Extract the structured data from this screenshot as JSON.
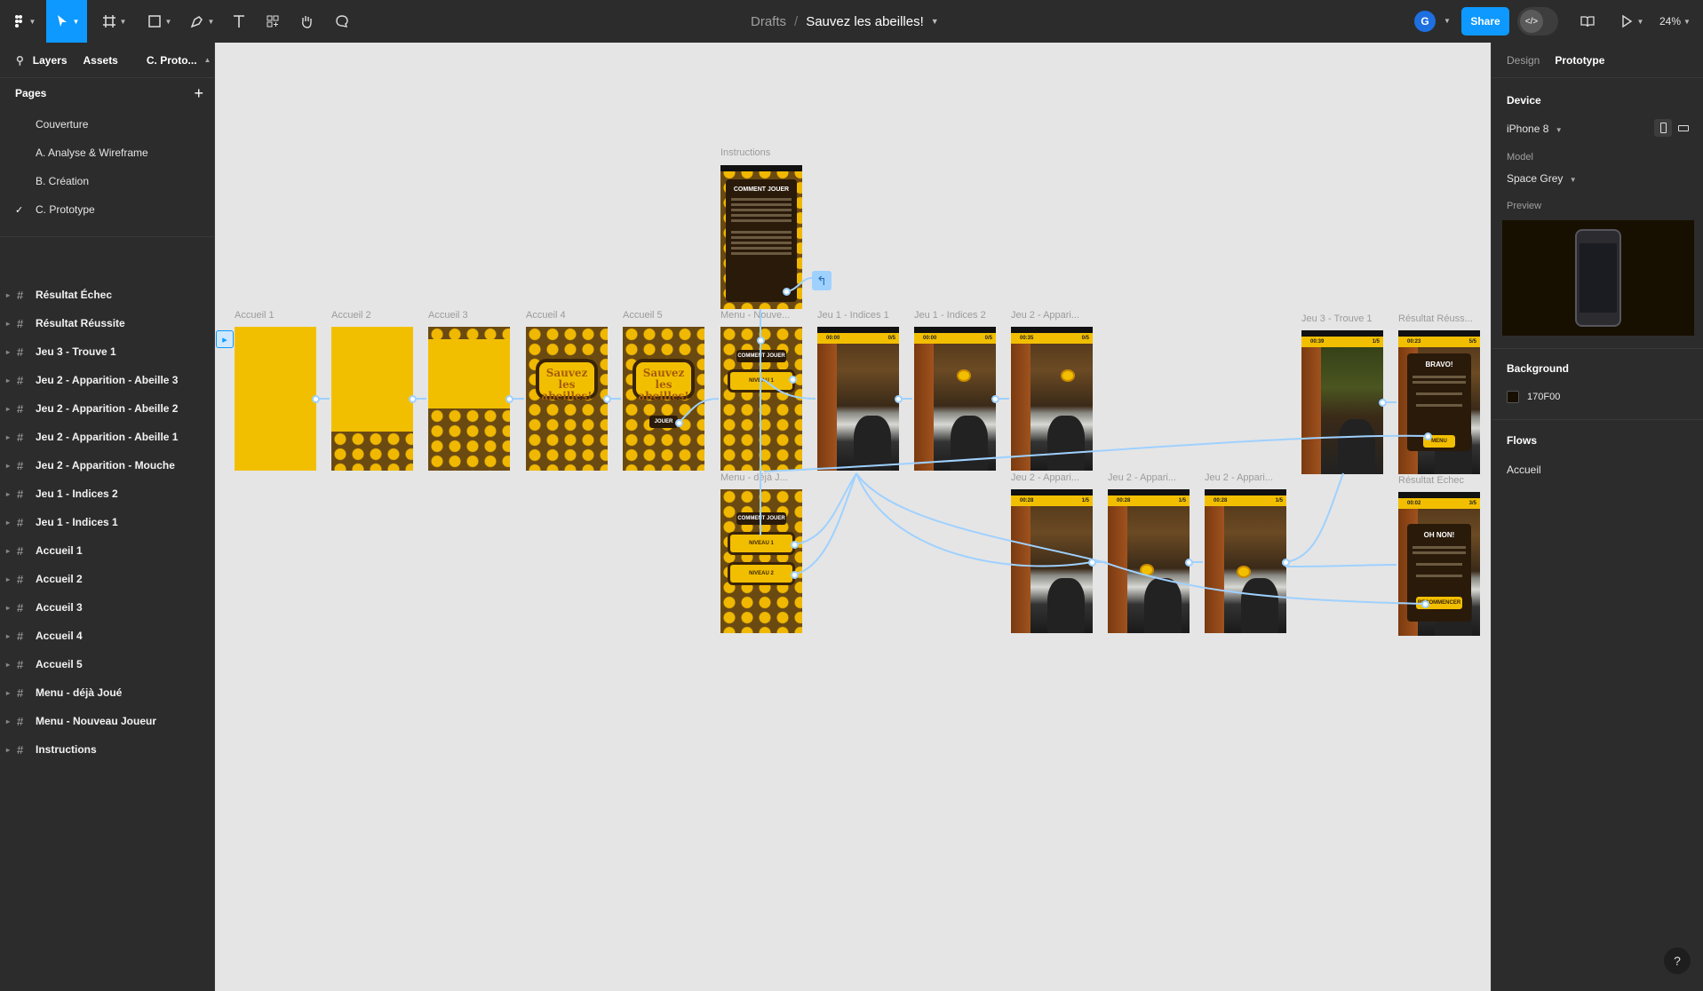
{
  "toolbar": {
    "menu_icon": "figma-logo-icon",
    "breadcrumb_drafts": "Drafts",
    "breadcrumb_sep": "/",
    "file_name": "Sauvez les abeilles!",
    "avatar_initial": "G",
    "share_label": "Share",
    "zoom": "24%"
  },
  "left_panel": {
    "tabs": [
      "Layers",
      "Assets",
      "C. Proto..."
    ],
    "pages_title": "Pages",
    "pages": [
      {
        "label": "Couverture",
        "checked": false
      },
      {
        "label": "A. Analyse & Wireframe",
        "checked": false
      },
      {
        "label": "B. Création",
        "checked": false
      },
      {
        "label": "C. Prototype",
        "checked": true
      }
    ],
    "layers": [
      "Résultat Échec",
      "Résultat Réussite",
      "Jeu 3 - Trouve 1",
      "Jeu 2 - Apparition - Abeille 3",
      "Jeu 2 - Apparition - Abeille 2",
      "Jeu 2 - Apparition - Abeille 1",
      "Jeu 2 - Apparition - Mouche",
      "Jeu 1 - Indices 2",
      "Jeu 1 - Indices 1",
      "Accueil 1",
      "Accueil 2",
      "Accueil 3",
      "Accueil 4",
      "Accueil 5",
      "Menu - déjà Joué",
      "Menu - Nouveau Joueur",
      "Instructions"
    ]
  },
  "canvas": {
    "frame_labels": {
      "instructions": "Instructions",
      "accueil1": "Accueil 1",
      "accueil2": "Accueil 2",
      "accueil3": "Accueil 3",
      "accueil4": "Accueil 4",
      "accueil5": "Accueil 5",
      "menu_nouveau": "Menu - Nouve...",
      "jeu1_indices1": "Jeu 1 - Indices 1",
      "jeu1_indices2": "Jeu 1 - Indices 2",
      "jeu2_appari_top": "Jeu 2 - Appari...",
      "jeu3_trouve1": "Jeu 3 - Trouve 1",
      "resultat_reussite": "Résultat Réuss...",
      "menu_deja": "Menu - déjà J...",
      "jeu2_appari_b1": "Jeu 2 - Appari...",
      "jeu2_appari_b2": "Jeu 2 - Appari...",
      "jeu2_appari_b3": "Jeu 2 - Appari...",
      "resultat_echec": "Résultat Echec"
    },
    "screen_text": {
      "comment_jouer": "COMMENT JOUER",
      "title_plate": "Sauvez les abeilles!",
      "jouer": "JOUER",
      "niveau1": "NIVEAU 1",
      "niveau2": "NIVEAU 2",
      "bravo": "BRAVO!",
      "oh_non": "OH NON!",
      "menu_btn": "MENU",
      "recommencer": "RECOMMENCER",
      "timer_a": "00:00",
      "timer_b": "00:35",
      "timer_c": "00:28",
      "timer_d": "00:39",
      "timer_e": "00:23",
      "timer_f": "00:02",
      "count_a": "0/5",
      "count_b": "1/5",
      "count_c": "5/5",
      "count_d": "3/5"
    }
  },
  "right_panel": {
    "tabs": [
      "Design",
      "Prototype"
    ],
    "active_tab": "Prototype",
    "device_title": "Device",
    "device_value": "iPhone 8",
    "model_label": "Model",
    "model_value": "Space Grey",
    "preview_label": "Preview",
    "background_title": "Background",
    "background_value": "170F00",
    "background_color": "#170F00",
    "flows_title": "Flows",
    "flow_name": "Accueil"
  },
  "colors": {
    "accent": "#0d99ff",
    "honey": "#f2bf00",
    "dark_brown": "#3a2407",
    "wire": "#9fd1ff"
  }
}
